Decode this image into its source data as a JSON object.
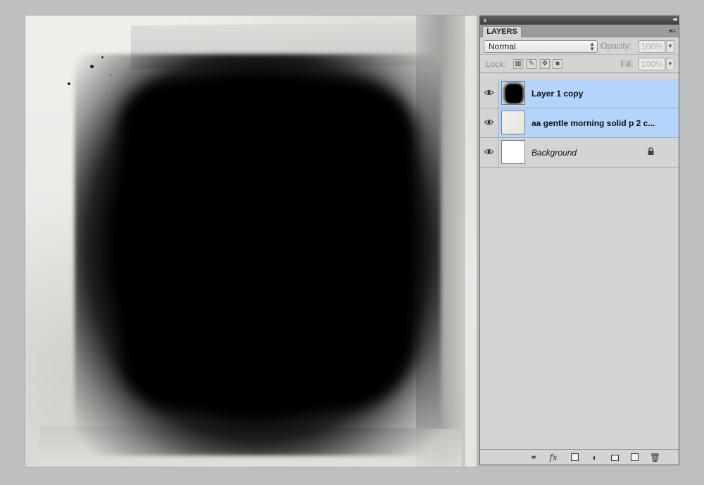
{
  "panel": {
    "tab_label": "LAYERS",
    "blend_mode": "Normal",
    "opacity_label": "Opacity:",
    "opacity_value": "100%",
    "lock_label": "Lock:",
    "fill_label": "Fill:",
    "fill_value": "100%"
  },
  "layers": [
    {
      "name": "Layer 1 copy",
      "selected": true,
      "visible": true,
      "thumb": "ink"
    },
    {
      "name": "aa gentle morning solid p 2 c...",
      "selected": true,
      "visible": true,
      "thumb": "paper"
    },
    {
      "name": "Background",
      "selected": false,
      "visible": true,
      "thumb": "white",
      "locked": true
    }
  ],
  "footer_icons": [
    "link-layers-icon",
    "fx-icon",
    "layer-mask-icon",
    "adjustment-layer-icon",
    "group-folder-icon",
    "new-layer-icon",
    "trash-icon"
  ],
  "colors": {
    "selection": "#b4d4fb",
    "panel_bg": "#d4d4d4",
    "app_bg": "#bfbfbf"
  }
}
